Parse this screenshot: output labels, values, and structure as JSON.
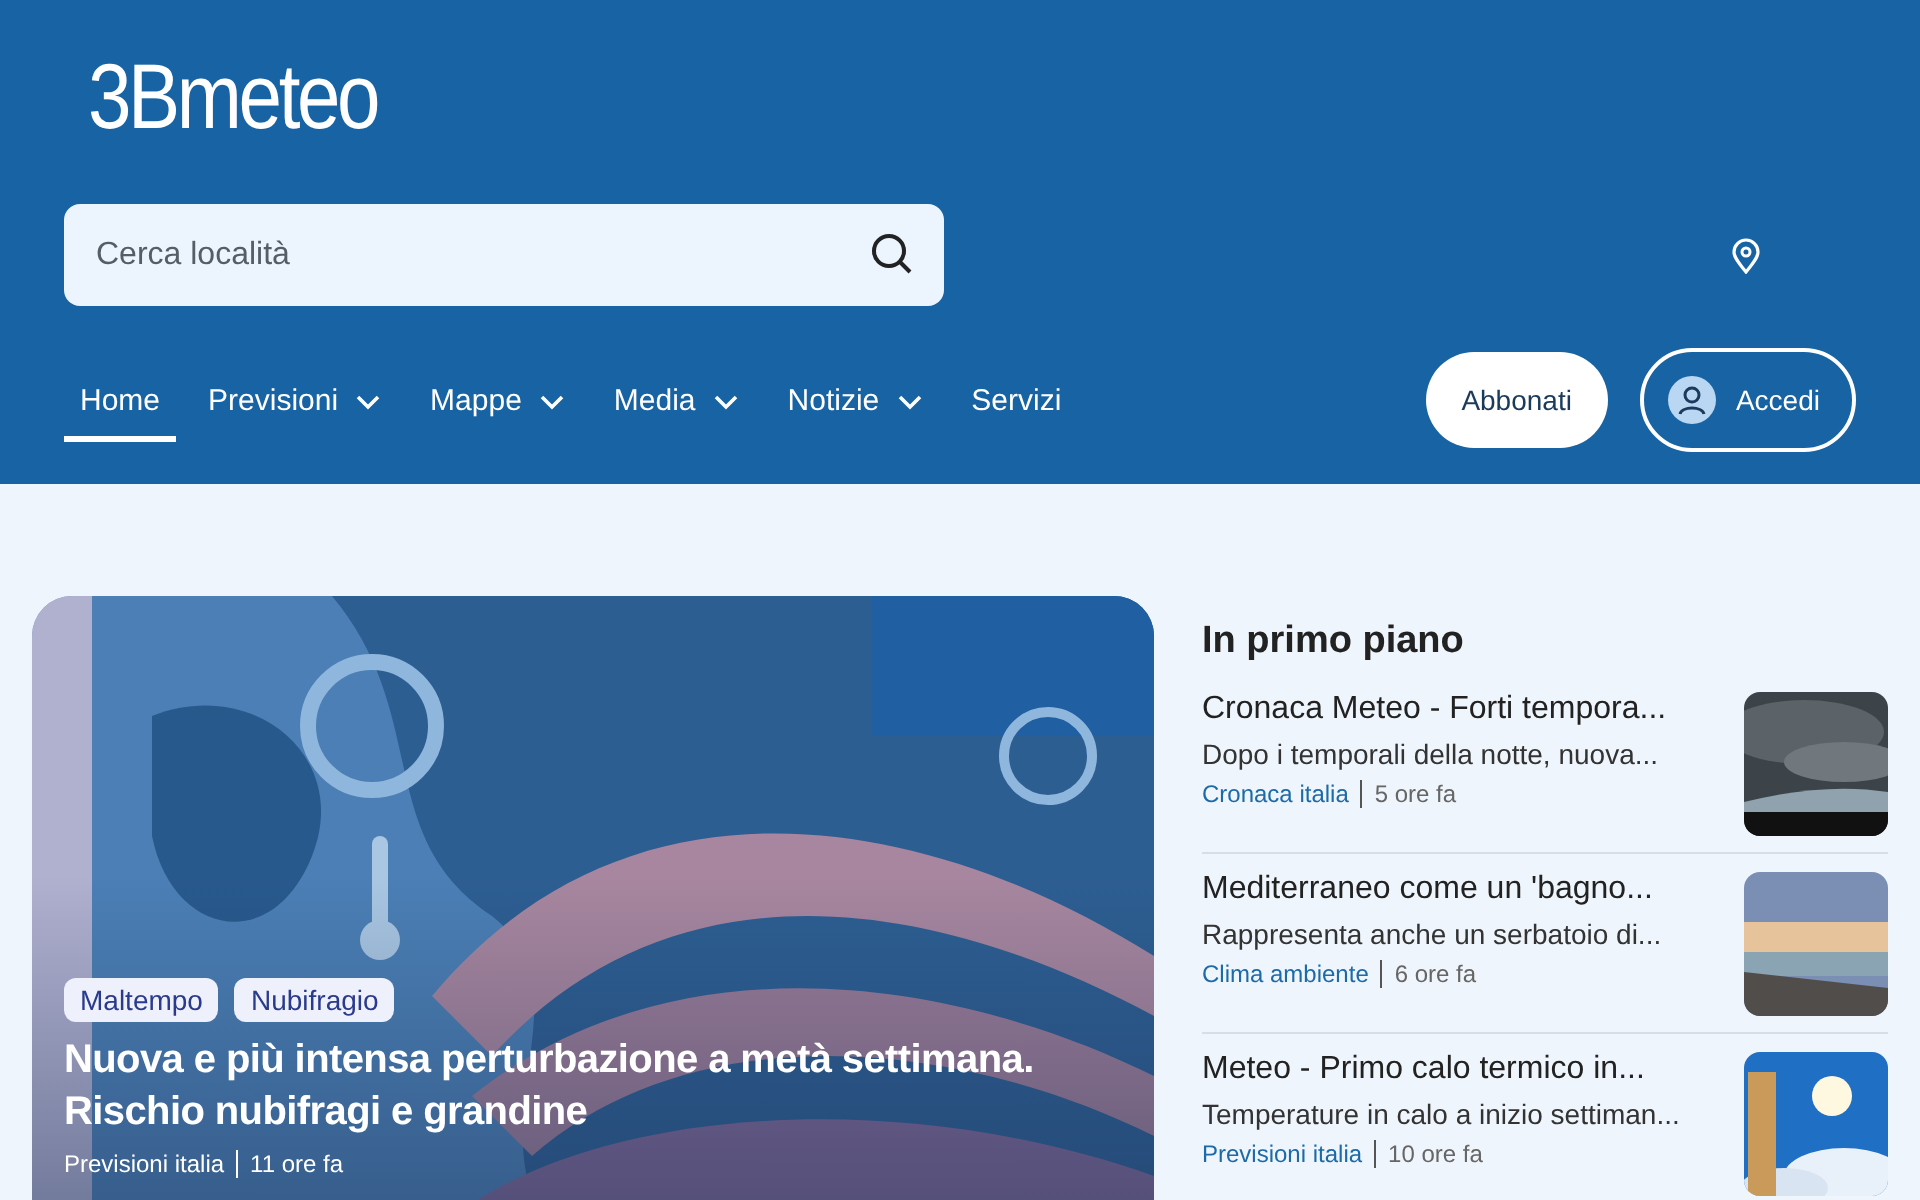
{
  "logo": "3Bmeteo",
  "search": {
    "placeholder": "Cerca località"
  },
  "nav": [
    {
      "label": "Home",
      "selected": true,
      "dropdown": false
    },
    {
      "label": "Previsioni",
      "selected": false,
      "dropdown": true
    },
    {
      "label": "Mappe",
      "selected": false,
      "dropdown": true
    },
    {
      "label": "Media",
      "selected": false,
      "dropdown": true
    },
    {
      "label": "Notizie",
      "selected": false,
      "dropdown": true
    },
    {
      "label": "Servizi",
      "selected": false,
      "dropdown": false
    }
  ],
  "subscribe_button": "Abbonati",
  "login_button": "Accedi",
  "hero": {
    "kind": "picture",
    "tags": [
      "Maltempo",
      "Nubifragio"
    ],
    "title": "Nuova e più intensa perturbazione a metà settimana. Rischio nubifragi e grandine",
    "category": "Previsioni italia",
    "time": "11 ore fa"
  },
  "featured": {
    "heading": "In primo piano",
    "articles": [
      {
        "title": "Cronaca Meteo - Forti tempora...",
        "summary": "Dopo i temporali della notte, nuova...",
        "category": "Cronaca italia",
        "time": "5 ore fa"
      },
      {
        "title": "Mediterraneo come un 'bagno...",
        "summary": "Rappresenta anche un serbatoio di...",
        "category": "Clima ambiente",
        "time": "6 ore fa"
      },
      {
        "title": "Meteo - Primo calo termico in...",
        "summary": "Temperature in calo a inizio settiman...",
        "category": "Previsioni italia",
        "time": "10 ore fa"
      }
    ]
  }
}
